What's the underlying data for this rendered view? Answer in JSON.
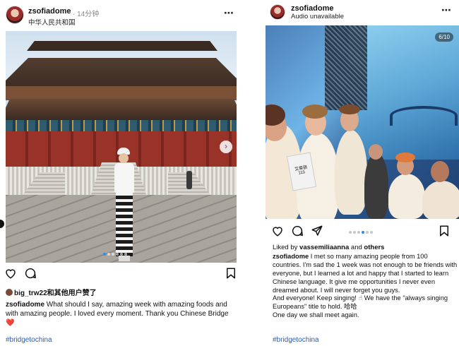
{
  "left_post": {
    "username": "zsofiadome",
    "time": "· 14分钟",
    "location": "中华人民共和国",
    "more_icon": "⋯",
    "next_icon": "›",
    "liked_by": "big_trw22和其他用户赞了",
    "caption_user": "zsofiadome",
    "caption_text": "What should I say, amazing week with amazing foods and with amazing people. I loved every moment. Thank you Chinese Bridge",
    "caption_heart": "❤️",
    "hashtag": "#bridgetochina",
    "carousel_dots": 6,
    "carousel_active": 0
  },
  "right_post": {
    "username": "zsofiadome",
    "audio": "Audio unavailable",
    "more_icon": "⋯",
    "slide_counter": "6/10",
    "badge_name": "艾莱丽",
    "badge_number": "115",
    "liked_prefix": "Liked by ",
    "liked_user": "vassemiliaanna",
    "liked_middle": " and ",
    "liked_others": "others",
    "caption_user": "zsofiadome",
    "caption_text": "I met so many amazing people from 100 countries. I'm sad the 1 week was not enough to be friends with everyone, but I learned a lot and happy that I started to learn Chinese language. It give me opportunities I never even dreamed about. I will never forget you guys.",
    "caption_line2": "And everyone! Keep singing! ☝ We have the \"always singing Europeans\" title to hold. 哈哈",
    "caption_line3": "One day we shall meet again.",
    "hashtag": "#bridgetochina",
    "carousel_dots": 6,
    "carousel_active": 3
  },
  "colors": {
    "accent_blue": "#2d8cf0",
    "hashtag_blue": "#2a5db0",
    "heart_red": "#e02a3a"
  },
  "icons": {
    "left_actions": [
      "heart-icon",
      "comment-icon",
      "bookmark-icon"
    ],
    "right_actions": [
      "heart-icon",
      "comment-icon",
      "share-icon",
      "bookmark-icon"
    ]
  }
}
